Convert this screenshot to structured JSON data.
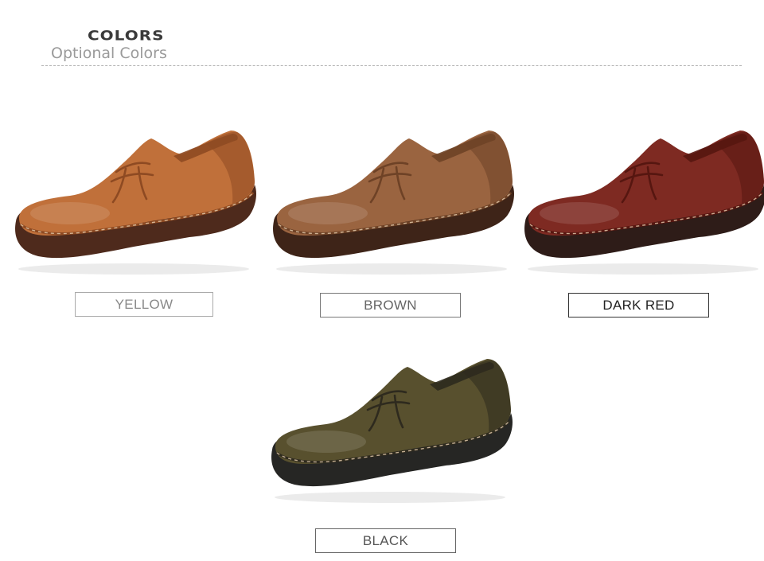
{
  "header": {
    "title": "COLORS",
    "subtitle": "Optional Colors"
  },
  "variants": [
    {
      "label": "YELLOW",
      "upper": "#c0703a",
      "shade": "#8e4a22",
      "sole": "#4e2a1c",
      "label_color": "#8a8a8a",
      "border_color": "#aaaaaa"
    },
    {
      "label": "BROWN",
      "upper": "#9a6440",
      "shade": "#6e4226",
      "sole": "#3e2418",
      "label_color": "#666666",
      "border_color": "#777777"
    },
    {
      "label": "DARK RED",
      "upper": "#7e2a22",
      "shade": "#561610",
      "sole": "#2e1c18",
      "label_color": "#222222",
      "border_color": "#333333"
    },
    {
      "label": "BLACK",
      "upper": "#58502e",
      "shade": "#2e2a1e",
      "sole": "#262624",
      "label_color": "#555555",
      "border_color": "#666666"
    }
  ]
}
